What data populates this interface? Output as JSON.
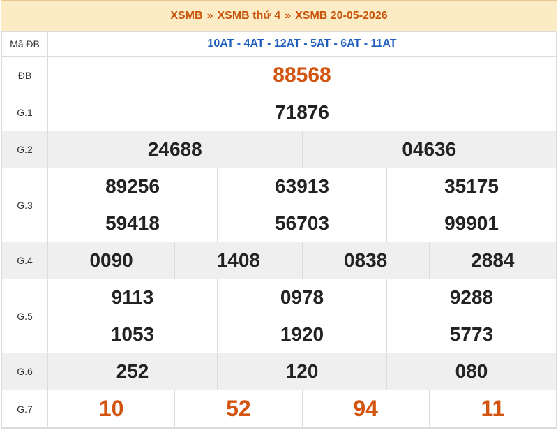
{
  "breadcrumb": {
    "home": "XSMB",
    "day": "XSMB thứ 4",
    "date": "XSMB 20-05-2026",
    "separator": "»"
  },
  "labels": {
    "ma_db": "Mã ĐB",
    "db": "ĐB",
    "g1": "G.1",
    "g2": "G.2",
    "g3": "G.3",
    "g4": "G.4",
    "g5": "G.5",
    "g6": "G.6",
    "g7": "G.7"
  },
  "ma_db_codes": "10AT - 4AT - 12AT - 5AT - 6AT - 11AT",
  "prizes": {
    "db": "88568",
    "g1": "71876",
    "g2": [
      "24688",
      "04636"
    ],
    "g3": [
      "89256",
      "63913",
      "35175",
      "59418",
      "56703",
      "99901"
    ],
    "g4": [
      "0090",
      "1408",
      "0838",
      "2884"
    ],
    "g5": [
      "9113",
      "0978",
      "9288",
      "1053",
      "1920",
      "5773"
    ],
    "g6": [
      "252",
      "120",
      "080"
    ],
    "g7": [
      "10",
      "52",
      "94",
      "11"
    ]
  },
  "colors": {
    "accent": "#d2540e",
    "header_bg": "#fbecc6",
    "code_blue": "#1f5fbf",
    "stripe": "#efefef"
  }
}
